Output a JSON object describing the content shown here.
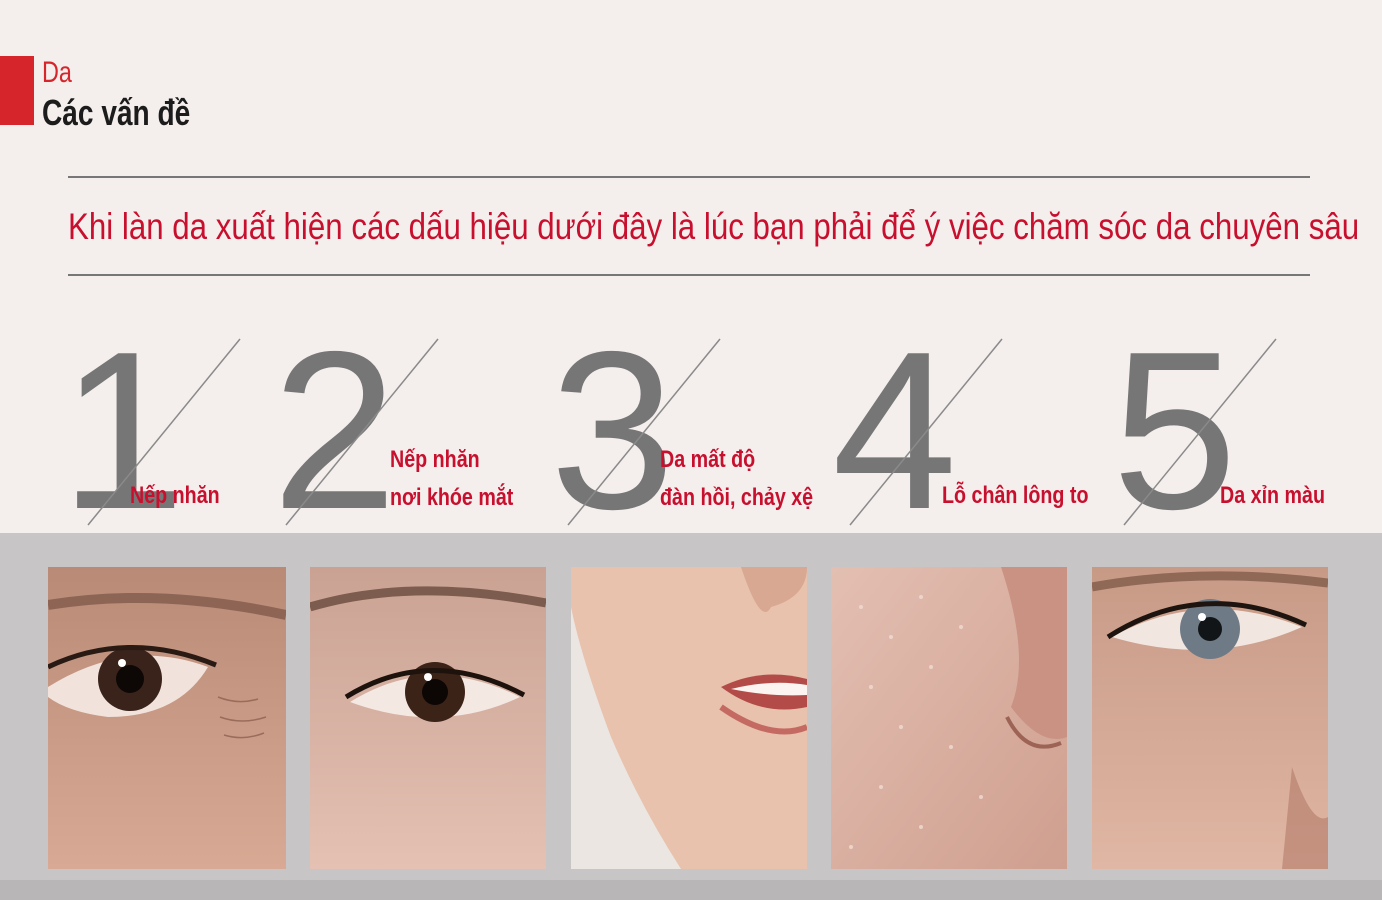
{
  "header": {
    "category": "Da",
    "title": "Các vấn đề"
  },
  "headline": "Khi làn da xuất hiện các dấu hiệu dưới đây là lúc bạn phải để ý việc chăm sóc da chuyên sâu",
  "steps": [
    {
      "number": "1",
      "label_lines": [
        "Nếp nhăn"
      ]
    },
    {
      "number": "2",
      "label_lines": [
        "Nếp nhăn",
        "nơi khóe mắt"
      ]
    },
    {
      "number": "3",
      "label_lines": [
        "Da mất độ",
        "đàn hồi, chảy xệ"
      ]
    },
    {
      "number": "4",
      "label_lines": [
        "Lỗ chân lông to"
      ]
    },
    {
      "number": "5",
      "label_lines": [
        "Da xỉn màu"
      ]
    }
  ],
  "colors": {
    "accent": "#d7262b",
    "headline": "#c8102e",
    "numbers": "#767676",
    "background": "#f4eeed",
    "band": "#c7c5c5"
  }
}
